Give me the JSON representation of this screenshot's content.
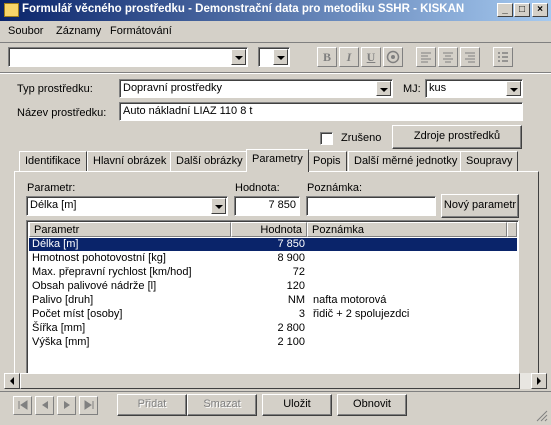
{
  "window": {
    "title": "Formulář věcného prostředku - Demonstrační data pro metodiku SSHR - KISKAN",
    "minimize": "_",
    "maximize": "□",
    "close": "×"
  },
  "menu": [
    "Soubor",
    "Záznamy",
    "Formátování"
  ],
  "toolbar": {
    "bold": "B",
    "italic": "I",
    "underline": "U"
  },
  "form": {
    "typ_label": "Typ prostředku:",
    "typ_value": "Dopravní prostředky",
    "mj_label": "MJ:",
    "mj_value": "kus",
    "nazev_label": "Název prostředku:",
    "nazev_value": "Auto nákladní LIAZ 110  8 t",
    "zruseno_label": "Zrušeno",
    "zdroje_button": "Zdroje prostředků"
  },
  "tabs": [
    "Identifikace",
    "Hlavní obrázek",
    "Další obrázky",
    "Parametry",
    "Popis",
    "Další měrné jednotky",
    "Soupravy"
  ],
  "active_tab": "Parametry",
  "parametry": {
    "parametr_label": "Parametr:",
    "parametr_value": "Délka [m]",
    "hodnota_label": "Hodnota:",
    "hodnota_value": "7 850",
    "poznamka_label": "Poznámka:",
    "poznamka_value": "",
    "novy_button": "Nový parametr"
  },
  "grid": {
    "columns": [
      "Parametr",
      "Hodnota",
      "Poznámka"
    ],
    "rows": [
      {
        "parametr": "Délka [m]",
        "hodnota": "7 850",
        "poznamka": "",
        "selected": true
      },
      {
        "parametr": "Hmotnost pohotovostní [kg]",
        "hodnota": "8 900",
        "poznamka": ""
      },
      {
        "parametr": "Max. přepravní rychlost [km/hod]",
        "hodnota": "72",
        "poznamka": ""
      },
      {
        "parametr": "Obsah palivové nádrže [l]",
        "hodnota": "120",
        "poznamka": ""
      },
      {
        "parametr": "Palivo [druh]",
        "hodnota": "NM",
        "poznamka": "nafta motorová"
      },
      {
        "parametr": "Počet míst [osoby]",
        "hodnota": "3",
        "poznamka": "řidič + 2 spolujezdci"
      },
      {
        "parametr": "Šířka [mm]",
        "hodnota": "2 800",
        "poznamka": ""
      },
      {
        "parametr": "Výška [mm]",
        "hodnota": "2 100",
        "poznamka": ""
      }
    ]
  },
  "bottom": {
    "pridat": "Přidat",
    "smazat": "Smazat",
    "ulozit": "Uložit",
    "obnovit": "Obnovit"
  },
  "colors": {
    "titlebar_start": "#0a246a",
    "titlebar_end": "#a6caf0",
    "selection": "#0a246a",
    "face": "#d4d0c8"
  }
}
